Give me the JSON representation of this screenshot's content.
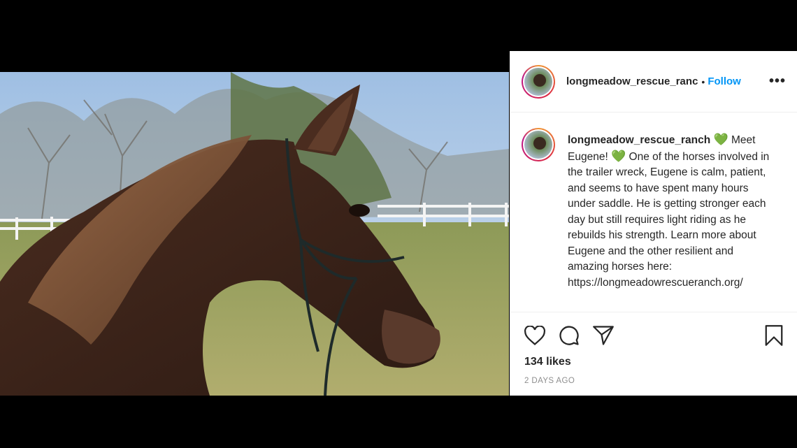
{
  "post": {
    "username": "longmeadow_rescue_ranc",
    "separator": "•",
    "follow_label": "Follow",
    "more_label": "•••",
    "photo_alt": "Brown horse wearing a rope halter in a fenced pasture"
  },
  "caption": {
    "username": "longmeadow_rescue_ranch",
    "emoji": "💚",
    "part1": "Meet Eugene!",
    "part2": "One of the horses involved in the trailer wreck, Eugene is calm, patient, and seems to have spent many hours under saddle. He is getting stronger each day but still requires light riding as he rebuilds his strength. Learn more about Eugene and the other resilient and amazing horses here: https://longmeadowrescueranch.org/"
  },
  "stats": {
    "likes": "134 likes",
    "posted": "2 DAYS AGO"
  },
  "icons": {
    "like": "heart-outline-icon",
    "comment": "comment-bubble-icon",
    "share": "paper-plane-icon",
    "save": "bookmark-icon"
  },
  "colors": {
    "follow": "#0095f6",
    "emoji_heart": "#2ecc40",
    "background": "#000000"
  }
}
